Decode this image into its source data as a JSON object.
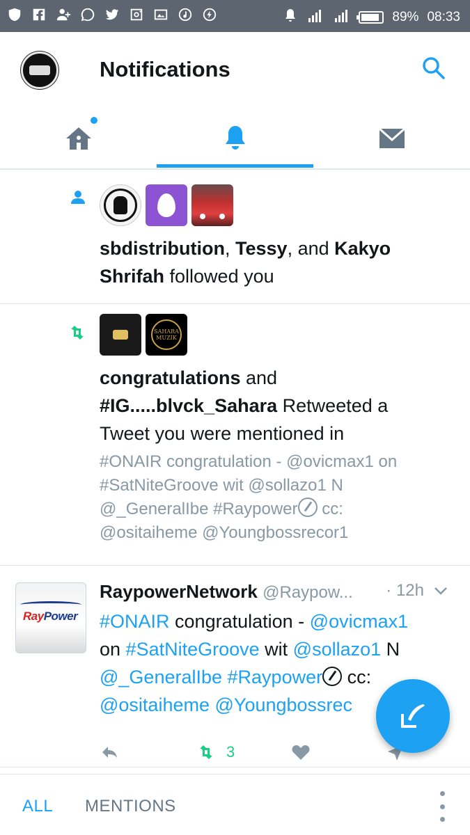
{
  "status_bar": {
    "battery": "89%",
    "time": "08:33",
    "left_icons": [
      "vpn-shield-icon",
      "facebook-icon",
      "add-user-icon",
      "whatsapp-icon",
      "twitter-icon",
      "instagram-icon",
      "gallery-icon",
      "music-icon",
      "flash-icon"
    ],
    "right_icons": [
      "alarm-mute-icon",
      "signal-4g-icon",
      "signal-icon",
      "battery-icon"
    ]
  },
  "header": {
    "title": "Notifications"
  },
  "tabs": [
    {
      "name": "home",
      "icon": "home-icon",
      "active": false,
      "has_dot": true
    },
    {
      "name": "notifications",
      "icon": "bell-icon",
      "active": true
    },
    {
      "name": "messages",
      "icon": "envelope-icon",
      "active": false
    }
  ],
  "notifications": [
    {
      "type": "follow",
      "icon": "person-icon",
      "users": [
        "sbdistribution",
        "Tessy",
        "Kakyo Shrifah"
      ],
      "sep1": ", ",
      "sep2": ", and ",
      "action": " followed you",
      "line1_user1": "sbdistribution",
      "line1_sep1": ", ",
      "line1_user2": "Tessy",
      "line1_sep2": ", and ",
      "line1_user3a": "Kakyo",
      "line2_user3b": "Shrifah",
      "line2_action": " followed you"
    },
    {
      "type": "retweet",
      "icon": "retweet-icon",
      "user1": "congratulations",
      "joiner": " and",
      "user2": "#IG.....blvck_Sahara",
      "action_a": " Retweeted a",
      "action_b": "Tweet you were mentioned in",
      "quote_lines": [
        "#ONAIR congratulation - @ovicmax1  on",
        "#SatNiteGroove wit @sollazo1 N",
        "@_GeneralIbe #Raypower",
        " cc:",
        "@ositaiheme @Youngbossrecor1"
      ],
      "sahara_badge": "SAHARA MUZIK"
    }
  ],
  "tweet": {
    "avatar_text_a": "Ray",
    "avatar_text_b": "Power",
    "name": "RaypowerNetwork",
    "handle": "@Raypow...",
    "time": "· 12h",
    "body": {
      "l1_link": "#ONAIR",
      "l1_text": " congratulation - ",
      "l1_mention": "@ovicmax1",
      "l2_text_a": "on ",
      "l2_link": "#SatNiteGroove",
      "l2_text_b": " wit ",
      "l2_mention": "@sollazo1",
      "l2_text_c": " N",
      "l3_mention": "@_GeneralIbe",
      "l3_space": " ",
      "l3_link": "#Raypower",
      "l3_text": " cc:",
      "l4_mention_a": "@ositaiheme",
      "l4_space": " ",
      "l4_mention_b": "@Youngbossrec"
    },
    "actions": {
      "retweet_count": "3"
    }
  },
  "fab": {
    "icon": "compose-icon"
  },
  "bottom_bar": {
    "all_label": "ALL",
    "mentions_label": "MENTIONS"
  },
  "colors": {
    "accent": "#1da1f2",
    "retweet_green": "#19cf86",
    "status_bar": "#5d6670",
    "muted": "#8899a6"
  }
}
